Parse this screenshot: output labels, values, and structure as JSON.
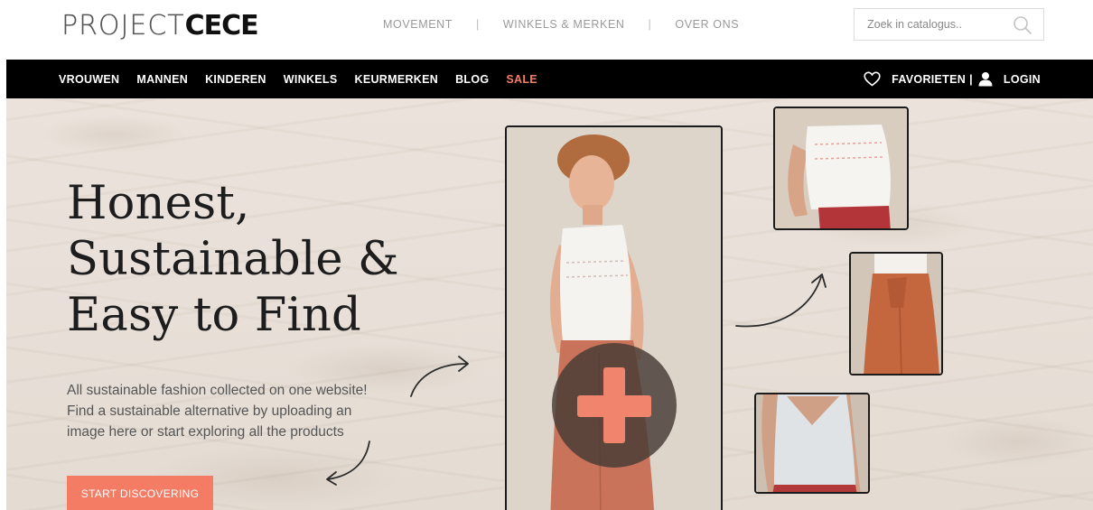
{
  "logo": {
    "light": "PROJECT",
    "bold": "CECE"
  },
  "top_nav": {
    "links": [
      "MOVEMENT",
      "WINKELS & MERKEN",
      "OVER ONS"
    ],
    "separator": "|"
  },
  "search": {
    "placeholder": "Zoek in catalogus..",
    "icon": "search-icon"
  },
  "main_nav": {
    "categories": [
      "VROUWEN",
      "MANNEN",
      "KINDEREN",
      "WINKELS",
      "KEURMERKEN",
      "BLOG",
      "SALE"
    ],
    "favorites_label": "FAVORIETEN",
    "separator": "|",
    "login_label": "LOGIN",
    "favorites_icon": "heart-icon",
    "login_icon": "user-icon"
  },
  "hero": {
    "title_lines": [
      "Honest,",
      "Sustainable &",
      "Easy to Find"
    ],
    "subtitle_lines": [
      "All sustainable fashion collected on one website!",
      "Find a sustainable alternative by uploading an",
      "image here or start exploring all the products"
    ],
    "cta_label": "START DISCOVERING"
  },
  "colors": {
    "accent": "#f47c64",
    "nav_background": "#000000",
    "text_dark": "#1d1d1d",
    "text_muted": "#9a9a9a"
  }
}
